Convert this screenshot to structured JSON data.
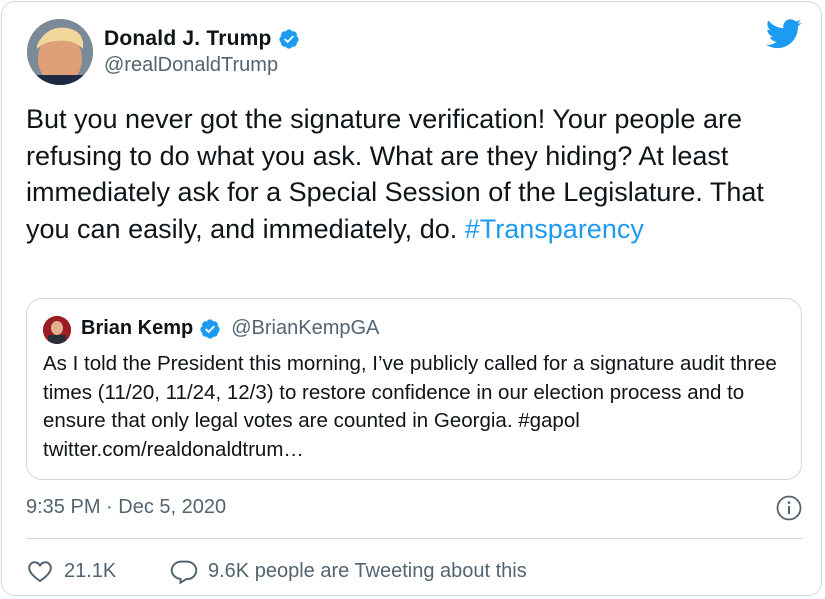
{
  "author": {
    "display_name": "Donald J. Trump",
    "handle": "@realDonaldTrump"
  },
  "tweet": {
    "text": "But you never got the signature verification! Your people are refusing to do what you ask. What are they hiding? At least immediately ask for a Special Session of the Legislature. That you can easily, and immediately, do.",
    "hashtag": "#Transparency"
  },
  "quoted_tweet": {
    "display_name": "Brian Kemp",
    "handle": "@BrianKempGA",
    "text": "As I told the President this morning, I’ve publicly called for a signature audit three times (11/20, 11/24, 12/3) to restore confidence in our election process and to ensure that only legal votes are counted in Georgia. #gapol twitter.com/realdonaldtrum…"
  },
  "timestamp": "9:35 PM · Dec 5, 2020",
  "actions": {
    "likes": "21.1K",
    "conversation": "9.6K people are Tweeting about this"
  },
  "colors": {
    "accent": "#1d9bf0",
    "secondary_text": "#536471",
    "border": "#cfd9de"
  },
  "icons": [
    "verified-badge-icon",
    "twitter-bird-icon",
    "info-icon",
    "heart-icon",
    "speech-bubble-icon"
  ]
}
